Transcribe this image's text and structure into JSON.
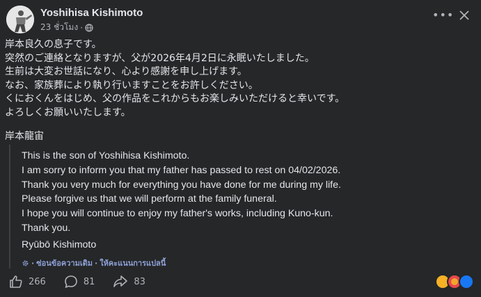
{
  "post": {
    "author": "Yoshihisa Kishimoto",
    "time": "23 ชั่วโมง",
    "separator": "·",
    "body_jp": [
      "岸本良久の息子です。",
      "突然のご連絡となりますが、父が2026年4月2日に永眠いたしました。",
      "生前は大変お世話になり、心より感謝を申し上げます。",
      "なお、家族葬により執り行いますことをお許しください。",
      "くにおくんをはじめ、父の作品をこれからもお楽しみいただけると幸いです。",
      "よろしくお願いいたします。"
    ],
    "signature_jp": "岸本龍宙",
    "translation": [
      "This is the son of Yoshihisa Kishimoto.",
      "I am sorry to inform you that my father has passed to rest on 04/02/2026.",
      "Thank you very much for everything you have done for me during my life.",
      "Please forgive us that we will perform at the family funeral.",
      "I hope you will continue to enjoy my father's works, including Kuno-kun.",
      "Thank you."
    ],
    "signature_en": "Ryūbō Kishimoto",
    "hide_original": "ซ่อนข้อความเดิม",
    "rate_translation": "ให้คะแนนการแปลนี้"
  },
  "stats": {
    "likes": "266",
    "comments": "81",
    "shares": "83"
  },
  "icons": {
    "menu": "more-horizontal-icon",
    "close": "close-icon",
    "audience": "globe-icon",
    "translate": "gear-icon",
    "like": "thumbs-up-icon",
    "comment": "comment-icon",
    "share": "share-icon"
  },
  "colors": {
    "background": "#252728",
    "text": "#e4e6eb",
    "muted": "#b0b3b8",
    "link": "#8ea0d6"
  }
}
